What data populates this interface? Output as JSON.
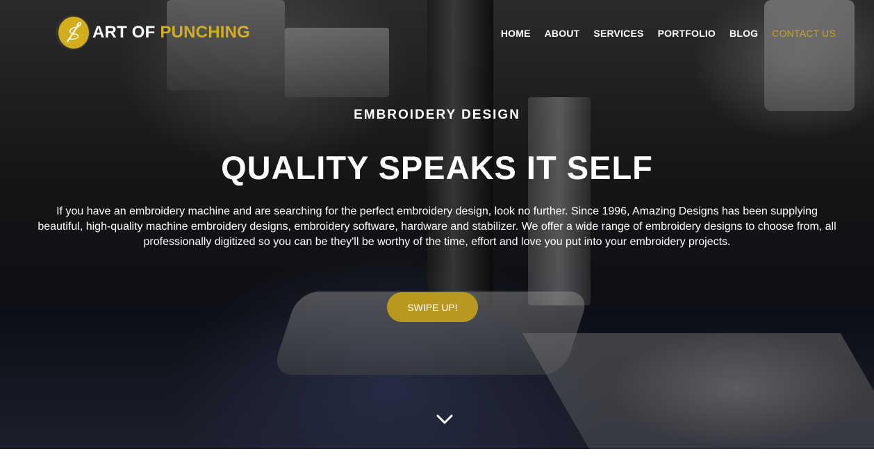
{
  "brand": {
    "name_part1": "ART OF",
    "name_part2": "PUNCHING",
    "logo_icon": "needle-thread-icon",
    "accent_color": "#d4ad1c"
  },
  "nav": {
    "items": [
      {
        "label": "HOME"
      },
      {
        "label": "ABOUT"
      },
      {
        "label": "SERVICES"
      },
      {
        "label": "PORTFOLIO"
      },
      {
        "label": "BLOG"
      },
      {
        "label": "CONTACT US",
        "active": true
      }
    ]
  },
  "hero": {
    "eyebrow": "EMBROIDERY DESIGN",
    "headline": "QUALITY SPEAKS IT SELF",
    "description": "If you have an embroidery machine and are searching for the perfect embroidery design, look no further. Since 1996, Amazing Designs has been supplying beautiful, high-quality machine embroidery designs, embroidery software, hardware and stabilizer. We offer a wide range of embroidery designs to choose from, all professionally digitized so you can be they'll be worthy of the time, effort and love you put into your embroidery projects.",
    "cta_label": "SWIPE UP!",
    "cta_color": "#b8981f",
    "scroll_icon": "chevron-down-icon"
  }
}
